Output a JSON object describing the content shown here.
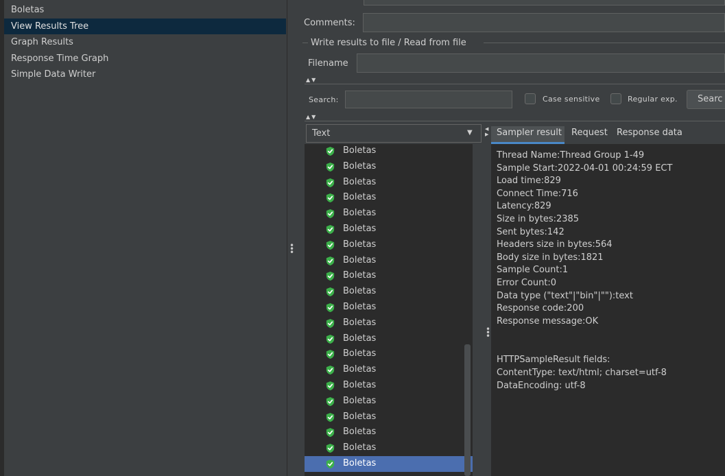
{
  "tree": {
    "items": [
      {
        "label": "Boletas",
        "selected": false
      },
      {
        "label": "View Results Tree",
        "selected": true
      },
      {
        "label": "Graph Results",
        "selected": false
      },
      {
        "label": "Response Time Graph",
        "selected": false
      },
      {
        "label": "Simple Data Writer",
        "selected": false
      }
    ]
  },
  "form": {
    "comments_label": "Comments:",
    "file_group_title": "Write results to file / Read from file",
    "filename_label": "Filename",
    "search_label": "Search:",
    "case_sensitive_label": "Case sensitive",
    "regular_exp_label": "Regular exp.",
    "search_button": "Searc"
  },
  "renderer": {
    "selected": "Text"
  },
  "results": {
    "item_label": "Boletas",
    "count": 21,
    "selected_index": 20,
    "status_icon": "check-shield-icon",
    "status_color": "#3cb04a"
  },
  "tabs": [
    "Sampler result",
    "Request",
    "Response data"
  ],
  "sampler": {
    "lines": [
      "Thread Name:Thread Group 1-49",
      "Sample Start:2022-04-01 00:24:59 ECT",
      "Load time:829",
      "Connect Time:716",
      "Latency:829",
      "Size in bytes:2385",
      "Sent bytes:142",
      "Headers size in bytes:564",
      "Body size in bytes:1821",
      "Sample Count:1",
      "Error Count:0",
      "Data type (\"text\"|\"bin\"|\"\"):text",
      "Response code:200",
      "Response message:OK"
    ],
    "fields_title": "HTTPSampleResult fields:",
    "fields": [
      "ContentType: text/html; charset=utf-8",
      "DataEncoding: utf-8"
    ]
  },
  "colors": {
    "selection": "#4b6eaf",
    "tree_selection": "#0d293e",
    "background": "#3c3f41"
  }
}
